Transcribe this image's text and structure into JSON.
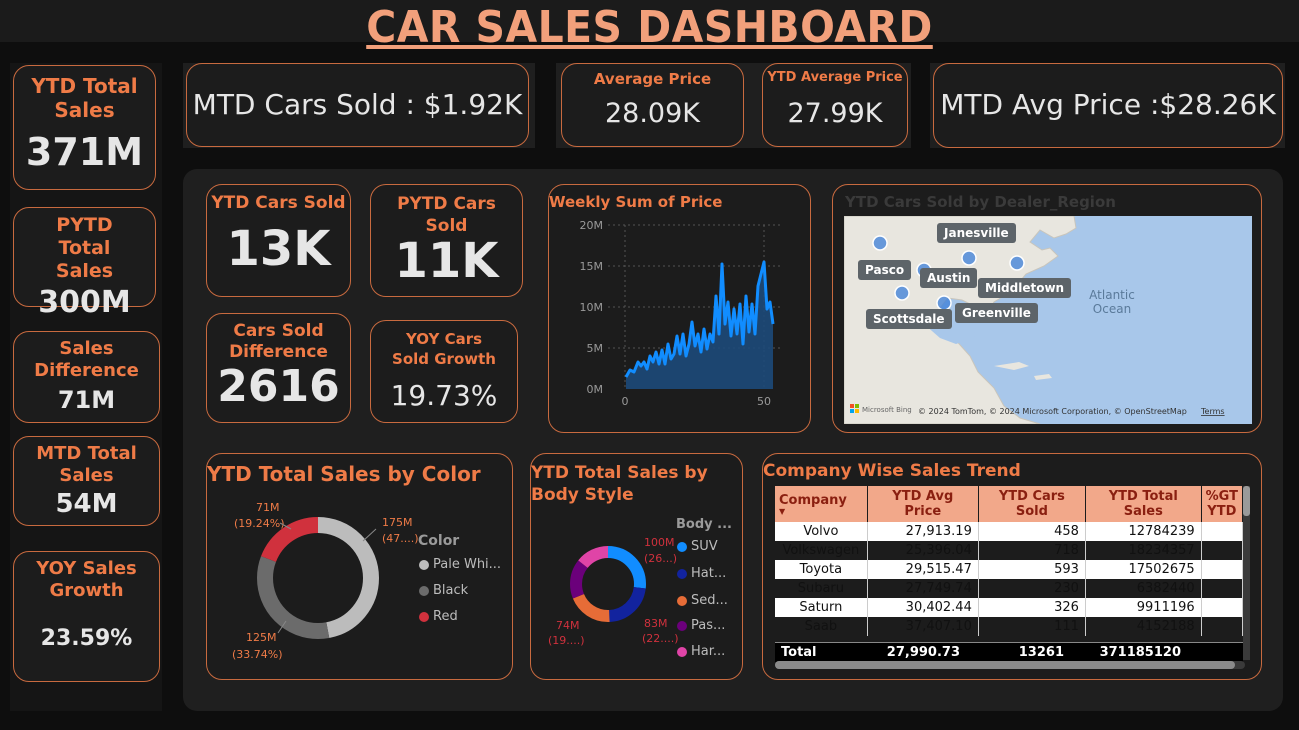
{
  "title": "CAR SALES DASHBOARD",
  "left_kpis": [
    {
      "label": "YTD Total Sales",
      "value": "371M"
    },
    {
      "label": "PYTD Total Sales",
      "value": "300M"
    },
    {
      "label": "Sales Difference",
      "value": "71M"
    },
    {
      "label": "MTD Total Sales",
      "value": "54M"
    },
    {
      "label": "YOY Sales Growth",
      "value": "23.59%"
    }
  ],
  "top_kpis": {
    "mtd_cars_sold": "MTD Cars Sold : $1.92K",
    "avg_price_label": "Average Price",
    "avg_price_value": "28.09K",
    "ytd_avg_price_label": "YTD Average Price",
    "ytd_avg_price_value": "27.99K",
    "mtd_avg_price": "MTD Avg Price :$28.26K"
  },
  "mid_kpis": [
    {
      "label": "YTD Cars Sold",
      "value": "13K"
    },
    {
      "label": "PYTD Cars Sold",
      "value": "11K"
    },
    {
      "label": "Cars Sold Difference",
      "value": "2616"
    },
    {
      "label": "YOY Cars Sold Growth",
      "value": "19.73%"
    }
  ],
  "weekly_chart": {
    "title": "Weekly Sum of Price",
    "y_ticks": [
      "20M",
      "15M",
      "10M",
      "5M",
      "0M"
    ],
    "x_ticks": [
      "0",
      "50"
    ],
    "color": "#118dff"
  },
  "map": {
    "title": "YTD Cars Sold by Dealer_Region",
    "ocean_label_1": "Atlantic",
    "ocean_label_2": "Ocean",
    "labels": [
      "Janesville",
      "Pasco",
      "Austin",
      "Middletown",
      "Scottsdale",
      "Greenville"
    ],
    "attribution": "© 2024 TomTom, © 2024 Microsoft Corporation, © OpenStreetMap",
    "terms": "Terms",
    "bing": "Microsoft Bing"
  },
  "color_donut": {
    "title": "YTD Total Sales by Color",
    "legend_title": "Color",
    "legend": [
      {
        "name": "Pale Whi...",
        "color": "#bcbcbc"
      },
      {
        "name": "Black",
        "color": "#6b6b6b"
      },
      {
        "name": "Red",
        "color": "#d0313d"
      }
    ],
    "labels": [
      {
        "value": "175M",
        "pct": "(47....)"
      },
      {
        "value": "125M",
        "pct": "(33.74%)"
      },
      {
        "value": "71M",
        "pct": "(19.24%)"
      }
    ]
  },
  "body_donut": {
    "title_1": "YTD Total Sales by",
    "title_2": "Body Style",
    "legend_title": "Body ...",
    "legend": [
      {
        "name": "SUV",
        "color": "#118dff"
      },
      {
        "name": "Hat...",
        "color": "#12239e"
      },
      {
        "name": "Sed...",
        "color": "#e66c37"
      },
      {
        "name": "Pas...",
        "color": "#6b007b"
      },
      {
        "name": "Har...",
        "color": "#e044a7"
      }
    ],
    "labels": [
      {
        "value": "100M",
        "pct": "(26...)"
      },
      {
        "value": "83M",
        "pct": "(22....)"
      },
      {
        "value": "74M",
        "pct": "(19....)"
      }
    ]
  },
  "company_table": {
    "title": "Company Wise Sales Trend",
    "headers": [
      "Company",
      "YTD Avg Price",
      "YTD Cars Sold",
      "YTD Total Sales",
      "%GT YTD"
    ],
    "rows": [
      [
        "Volvo",
        "27,913.19",
        "458",
        "12784239",
        ""
      ],
      [
        "Volkswagen",
        "25,396.04",
        "718",
        "18234357",
        ""
      ],
      [
        "Toyota",
        "29,515.47",
        "593",
        "17502675",
        ""
      ],
      [
        "Subaru",
        "27,749.74",
        "230",
        "6382440",
        ""
      ],
      [
        "Saturn",
        "30,402.44",
        "326",
        "9911196",
        ""
      ],
      [
        "Saab",
        "37,407.10",
        "111",
        "4152188",
        ""
      ]
    ],
    "total": [
      "Total",
      "27,990.73",
      "13261",
      "371185120",
      ""
    ]
  }
}
